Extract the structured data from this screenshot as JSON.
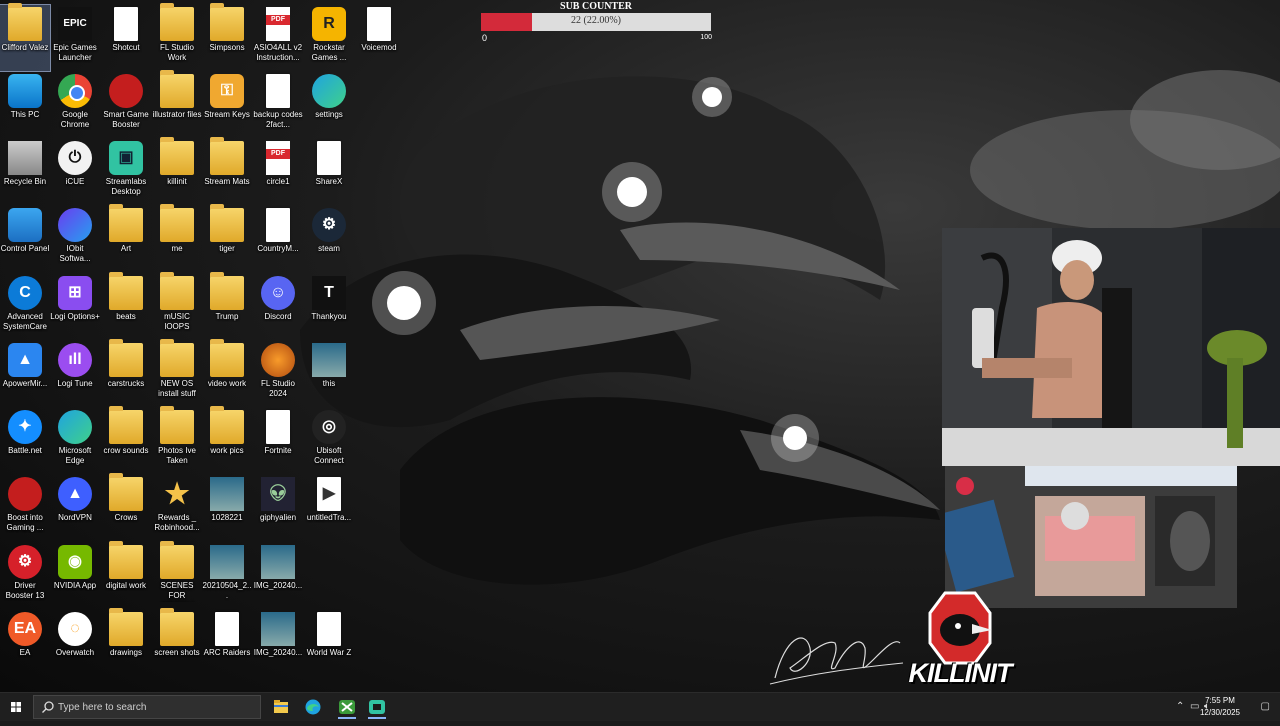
{
  "sub_counter": {
    "title": "SUB COUNTER",
    "value_text": "22 (22.00%)",
    "progress_fraction": 0.22,
    "min": "0",
    "max": "100",
    "fill_color": "#d32a3a"
  },
  "desktop_icons": [
    {
      "label": "Clifford Valez",
      "icon": "user-folder-icon",
      "col": 0,
      "row": 0,
      "selected": true
    },
    {
      "label": "Epic Games Launcher",
      "icon": "epic-games-icon",
      "col": 1,
      "row": 0
    },
    {
      "label": "Shotcut",
      "icon": "file-icon",
      "col": 2,
      "row": 0
    },
    {
      "label": "FL Studio Work",
      "icon": "folder-icon",
      "col": 3,
      "row": 0
    },
    {
      "label": "Simpsons",
      "icon": "folder-icon",
      "col": 4,
      "row": 0
    },
    {
      "label": "ASIO4ALL v2 Instruction...",
      "icon": "pdf-icon",
      "col": 5,
      "row": 0
    },
    {
      "label": "Rockstar Games ...",
      "icon": "rockstar-icon",
      "col": 6,
      "row": 0
    },
    {
      "label": "Voicemod",
      "icon": "file-icon",
      "col": 7,
      "row": 0
    },
    {
      "label": "This PC",
      "icon": "computer-icon",
      "col": 0,
      "row": 1
    },
    {
      "label": "Google Chrome",
      "icon": "chrome-icon",
      "col": 1,
      "row": 1
    },
    {
      "label": "Smart Game Booster",
      "icon": "game-booster-icon",
      "col": 2,
      "row": 1
    },
    {
      "label": "illustrator files",
      "icon": "folder-icon",
      "col": 3,
      "row": 1
    },
    {
      "label": "Stream Keys",
      "icon": "keys-icon",
      "col": 4,
      "row": 1
    },
    {
      "label": "backup codes 2fact...",
      "icon": "file-icon",
      "col": 5,
      "row": 1
    },
    {
      "label": "settings",
      "icon": "edge-icon",
      "col": 6,
      "row": 1
    },
    {
      "label": "Recycle Bin",
      "icon": "recycle-bin-icon",
      "col": 0,
      "row": 2
    },
    {
      "label": "iCUE",
      "icon": "icue-icon",
      "col": 1,
      "row": 2
    },
    {
      "label": "Streamlabs Desktop",
      "icon": "streamlabs-icon",
      "col": 2,
      "row": 2
    },
    {
      "label": "killinit",
      "icon": "folder-icon",
      "col": 3,
      "row": 2
    },
    {
      "label": "Stream Mats",
      "icon": "folder-icon",
      "col": 4,
      "row": 2
    },
    {
      "label": "circle1",
      "icon": "pdf-icon",
      "col": 5,
      "row": 2
    },
    {
      "label": "ShareX",
      "icon": "file-icon",
      "col": 6,
      "row": 2
    },
    {
      "label": "Control Panel",
      "icon": "control-panel-icon",
      "col": 0,
      "row": 3
    },
    {
      "label": "IObit Softwa...",
      "icon": "iobit-icon",
      "col": 1,
      "row": 3
    },
    {
      "label": "Art",
      "icon": "folder-icon",
      "col": 2,
      "row": 3
    },
    {
      "label": "me",
      "icon": "folder-icon",
      "col": 3,
      "row": 3
    },
    {
      "label": "tiger",
      "icon": "folder-icon",
      "col": 4,
      "row": 3
    },
    {
      "label": "CountryM...",
      "icon": "file-icon",
      "col": 5,
      "row": 3
    },
    {
      "label": "steam",
      "icon": "steam-icon",
      "col": 6,
      "row": 3
    },
    {
      "label": "Advanced SystemCare",
      "icon": "systemcare-icon",
      "col": 0,
      "row": 4
    },
    {
      "label": "Logi Options+",
      "icon": "logi-options-icon",
      "col": 1,
      "row": 4
    },
    {
      "label": "beats",
      "icon": "folder-icon",
      "col": 2,
      "row": 4
    },
    {
      "label": "mUSIC lOOPS",
      "icon": "folder-icon",
      "col": 3,
      "row": 4
    },
    {
      "label": "Trump",
      "icon": "folder-icon",
      "col": 4,
      "row": 4
    },
    {
      "label": "Discord",
      "icon": "discord-icon",
      "col": 5,
      "row": 4
    },
    {
      "label": "Thankyou",
      "icon": "thankyou-image-icon",
      "col": 6,
      "row": 4
    },
    {
      "label": "ApowerMir...",
      "icon": "apowermirror-icon",
      "col": 0,
      "row": 5
    },
    {
      "label": "Logi Tune",
      "icon": "logi-tune-icon",
      "col": 1,
      "row": 5
    },
    {
      "label": "carstrucks",
      "icon": "folder-icon",
      "col": 2,
      "row": 5
    },
    {
      "label": "NEW OS install stuff",
      "icon": "folder-icon",
      "col": 3,
      "row": 5
    },
    {
      "label": "video work",
      "icon": "folder-icon",
      "col": 4,
      "row": 5
    },
    {
      "label": "FL Studio 2024",
      "icon": "fl-studio-icon",
      "col": 5,
      "row": 5
    },
    {
      "label": "this",
      "icon": "image-icon",
      "col": 6,
      "row": 5
    },
    {
      "label": "Battle.net",
      "icon": "battlenet-icon",
      "col": 0,
      "row": 6
    },
    {
      "label": "Microsoft Edge",
      "icon": "edge-icon",
      "col": 1,
      "row": 6
    },
    {
      "label": "crow sounds",
      "icon": "folder-icon",
      "col": 2,
      "row": 6
    },
    {
      "label": "Photos Ive Taken",
      "icon": "folder-icon",
      "col": 3,
      "row": 6
    },
    {
      "label": "work pics",
      "icon": "folder-icon",
      "col": 4,
      "row": 6
    },
    {
      "label": "Fortnite",
      "icon": "file-icon",
      "col": 5,
      "row": 6
    },
    {
      "label": "Ubisoft Connect",
      "icon": "ubisoft-icon",
      "col": 6,
      "row": 6
    },
    {
      "label": "Boost into Gaming ...",
      "icon": "game-booster-icon",
      "col": 0,
      "row": 7
    },
    {
      "label": "NordVPN",
      "icon": "nordvpn-icon",
      "col": 1,
      "row": 7
    },
    {
      "label": "Crows",
      "icon": "folder-icon",
      "col": 2,
      "row": 7
    },
    {
      "label": "Rewards _ Robinhood...",
      "icon": "star-icon",
      "col": 3,
      "row": 7
    },
    {
      "label": "1028221",
      "icon": "image-icon",
      "col": 4,
      "row": 7
    },
    {
      "label": "giphyalien",
      "icon": "alien-image-icon",
      "col": 5,
      "row": 7
    },
    {
      "label": "untitledTra...",
      "icon": "video-file-icon",
      "col": 6,
      "row": 7
    },
    {
      "label": "Driver Booster 13",
      "icon": "driver-booster-icon",
      "col": 0,
      "row": 8
    },
    {
      "label": "NVIDIA App",
      "icon": "nvidia-icon",
      "col": 1,
      "row": 8
    },
    {
      "label": "digital work",
      "icon": "folder-icon",
      "col": 2,
      "row": 8
    },
    {
      "label": "SCENES FOR STREAM",
      "icon": "folder-icon",
      "col": 3,
      "row": 8
    },
    {
      "label": "20210504_2...",
      "icon": "image-icon",
      "col": 4,
      "row": 8
    },
    {
      "label": "IMG_20240...",
      "icon": "image-icon",
      "col": 5,
      "row": 8
    },
    {
      "label": "EA",
      "icon": "ea-icon",
      "col": 0,
      "row": 9
    },
    {
      "label": "Overwatch",
      "icon": "overwatch-icon",
      "col": 1,
      "row": 9
    },
    {
      "label": "drawings",
      "icon": "folder-icon",
      "col": 2,
      "row": 9
    },
    {
      "label": "screen shots",
      "icon": "folder-icon",
      "col": 3,
      "row": 9
    },
    {
      "label": "ARC Raiders",
      "icon": "file-icon",
      "col": 4,
      "row": 9
    },
    {
      "label": "IMG_20240...",
      "icon": "image-icon",
      "col": 5,
      "row": 9
    },
    {
      "label": "World War Z",
      "icon": "file-icon",
      "col": 6,
      "row": 9
    }
  ],
  "overlay": {
    "logo_text": "KILLINIT"
  },
  "taskbar": {
    "search_placeholder": "Type here to search",
    "apps": [
      "file-explorer-icon",
      "edge-icon",
      "xbox-icon",
      "streamlabs-icon"
    ],
    "clock_time": "7:55 PM",
    "clock_date": "12/30/2025"
  },
  "colors": {
    "taskbar_bg": "#1f1f1f",
    "accent": "#d32a3a"
  }
}
